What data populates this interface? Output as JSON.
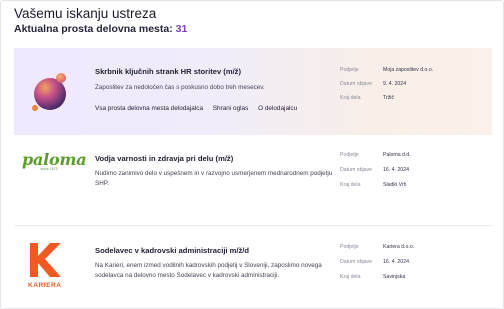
{
  "header": {
    "title": "Vašemu iskanju ustreza",
    "subtitle_label": "Aktualna prosta delovna mesta:",
    "count": "31"
  },
  "jobs": [
    {
      "title": "Skrbnik ključnih strank HR storitev (m/ž)",
      "description": "Zaposlitev za nedoločen čas s poskusno dobo treh mesecev.",
      "links": [
        "Vsa prosta delovna mesta delodajalca",
        "Shrani oglas",
        "O delodajalcu"
      ],
      "meta": [
        {
          "key": "Podjetje",
          "value": "Moja zaposlitev d.o.o."
        },
        {
          "key": "Datum objave",
          "value": "9. 4. 2024"
        },
        {
          "key": "Kraj dela",
          "value": "Tržič"
        }
      ]
    },
    {
      "title": "Vodja varnosti in zdravja pri delu (m/ž)",
      "description": "Nudimo zanimivo delo v uspešnem in v razvojno usmerjenem mednarodnem podjetju SHP.",
      "logo_text": "paloma",
      "logo_subtext": "since 1873",
      "meta": [
        {
          "key": "Podjetje",
          "value": "Paloma d.d."
        },
        {
          "key": "Datum objave",
          "value": "16. 4. 2024"
        },
        {
          "key": "Kraj dela",
          "value": "Sladki Vrh"
        }
      ]
    },
    {
      "title": "Sodelavec v kadrovski administraciji m/ž/d",
      "description": "Na Karieri, enem izmed vodilnih kadrovskih podjetij v Sloveniji, zaposlimo novega sodelavca na delovno mesto Sodelavec v kadrovski administraciji.",
      "logo_text": "KARIERA",
      "meta": [
        {
          "key": "Podjetje",
          "value": "Kariera d.o.o."
        },
        {
          "key": "Datum objave",
          "value": "16. 4. 2024"
        },
        {
          "key": "Kraj dela",
          "value": "Savinjska"
        }
      ]
    }
  ],
  "colors": {
    "accent": "#7b3fc4",
    "paloma_green": "#5a9e2a",
    "kariera_orange": "#f15a22"
  }
}
